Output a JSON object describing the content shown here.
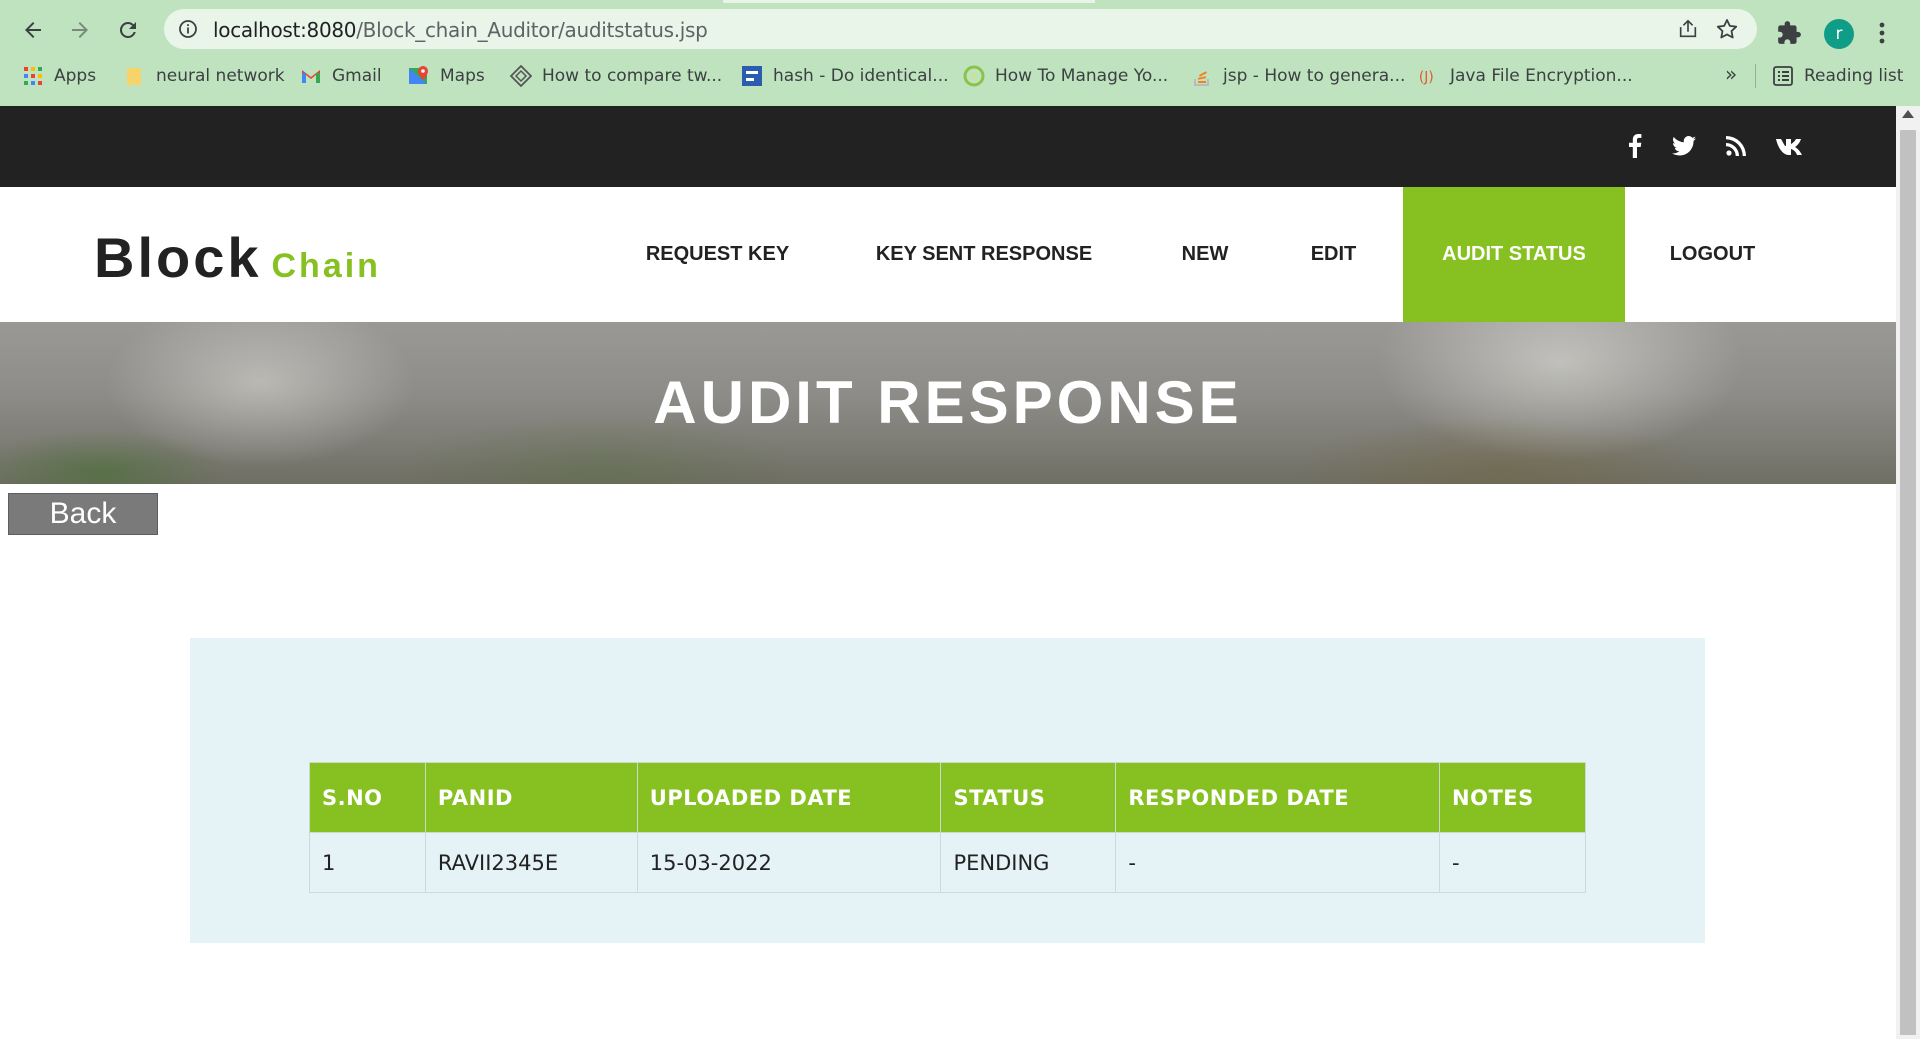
{
  "browser": {
    "url_host": "localhost:8080",
    "url_path": "/Block_chain_Auditor/auditstatus.jsp",
    "profile_initial": "r",
    "bookmarks": [
      {
        "label": "Apps",
        "icon": "apps-grid-icon"
      },
      {
        "label": "neural network",
        "icon": "folder-icon"
      },
      {
        "label": "Gmail",
        "icon": "gmail-icon"
      },
      {
        "label": "Maps",
        "icon": "maps-icon"
      },
      {
        "label": "How to compare tw...",
        "icon": "site-icon"
      },
      {
        "label": "hash - Do identical...",
        "icon": "site-icon"
      },
      {
        "label": "How To Manage Yo...",
        "icon": "site-icon"
      },
      {
        "label": "jsp - How to genera...",
        "icon": "stackoverflow-icon"
      },
      {
        "label": "Java File Encryption...",
        "icon": "site-icon"
      }
    ],
    "bookmarks_more": "»",
    "reading_list": "Reading list"
  },
  "site": {
    "logo_main": "Block",
    "logo_sub": "Chain",
    "social": [
      "facebook-icon",
      "twitter-icon",
      "rss-icon",
      "vk-icon"
    ],
    "nav": [
      {
        "label": "REQUEST KEY",
        "active": false
      },
      {
        "label": "KEY SENT RESPONSE",
        "active": false
      },
      {
        "label": "NEW",
        "active": false
      },
      {
        "label": "EDIT",
        "active": false
      },
      {
        "label": "AUDIT STATUS",
        "active": true
      },
      {
        "label": "LOGOUT",
        "active": false
      }
    ],
    "banner_title": "AUDIT RESPONSE",
    "back_label": "Back"
  },
  "table": {
    "headers": [
      "S.NO",
      "PANID",
      "UPLOADED DATE",
      "STATUS",
      "RESPONDED DATE",
      "NOTES"
    ],
    "rows": [
      [
        "1",
        "RAVII2345E",
        "15-03-2022",
        "PENDING",
        "-",
        "-"
      ]
    ]
  },
  "colors": {
    "accent": "#86c121",
    "topbar": "#222222",
    "panel": "#e5f3f7",
    "browser_chrome": "#bfe3bf"
  }
}
